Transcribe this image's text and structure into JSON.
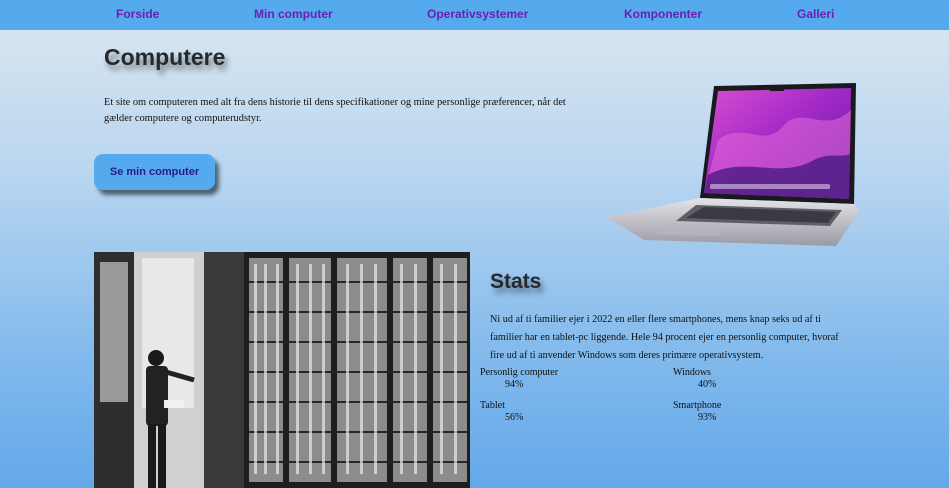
{
  "nav": {
    "items": [
      {
        "label": "Forside"
      },
      {
        "label": "Min computer"
      },
      {
        "label": "Operativsystemer"
      },
      {
        "label": "Komponenter"
      },
      {
        "label": "Galleri"
      }
    ]
  },
  "hero": {
    "title": "Computere",
    "text": "Et site om computeren med alt fra dens historie til dens specifikationer og mine personlige præferencer, når det gælder computere og computerudstyr.",
    "button_label": "Se min computer"
  },
  "stats": {
    "title": "Stats",
    "text": "Ni ud af ti familier ejer i 2022 en eller flere smartphones, mens knap seks ud af ti familier har en tablet-pc liggende. Hele 94 procent ejer en personlig computer, hvoraf fire ud af ti anvender Windows som deres primære operativsystem.",
    "items": [
      {
        "label": "Personlig computer",
        "value": "94%"
      },
      {
        "label": "Windows",
        "value": "40%"
      },
      {
        "label": "Tablet",
        "value": "56%"
      },
      {
        "label": "Smartphone",
        "value": "93%"
      }
    ]
  },
  "colors": {
    "nav_bg": "#55aaee",
    "nav_link": "#6a1fb5",
    "button_bg": "#55aaee",
    "button_text": "#2b1a86"
  }
}
